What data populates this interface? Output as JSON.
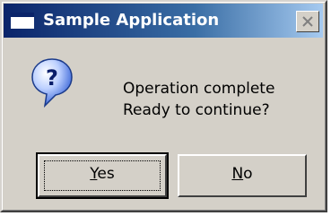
{
  "window": {
    "title": "Sample Application",
    "close_icon": "close-icon"
  },
  "message": {
    "icon": "question-icon",
    "line1": "Operation complete",
    "line2": "Ready to continue?"
  },
  "buttons": {
    "yes": {
      "accel": "Y",
      "rest": "es",
      "default": true
    },
    "no": {
      "accel": "N",
      "rest": "o",
      "default": false
    }
  },
  "colors": {
    "titlebar_start": "#0a246a",
    "titlebar_end": "#a6caf0",
    "face": "#d4d0c8",
    "icon_blue": "#2d5bd4"
  }
}
